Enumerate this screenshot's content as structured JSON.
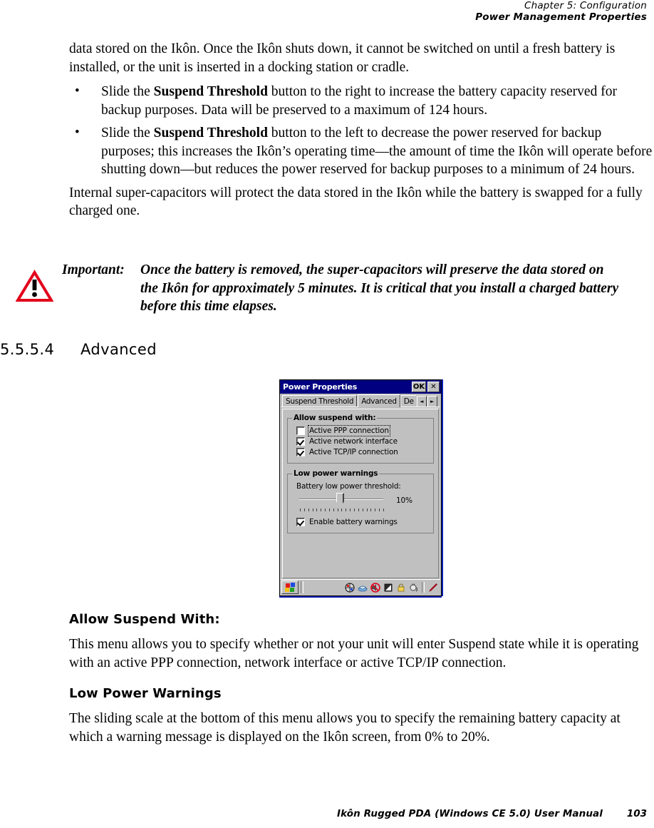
{
  "header": {
    "line1": "Chapter 5: Configuration",
    "line2": "Power Management Properties"
  },
  "body": {
    "intro": "data stored on the Ikôn. Once the Ikôn shuts down, it cannot be switched on until a fresh battery is installed, or the unit is inserted in a docking station or cradle.",
    "bullets": [
      {
        "pre": "Slide the ",
        "bold": "Suspend Threshold",
        "post": " button to the right to increase the battery capacity reserved for backup purposes. Data will be preserved to a maximum of 124 hours."
      },
      {
        "pre": "Slide the ",
        "bold": "Suspend Threshold",
        "post": " button to the left to decrease the power reserved for backup purposes; this increases the Ikôn’s operating time—the amount of time the Ikôn will operate before shutting down—but reduces the power reserved for backup purposes to a minimum of 24 hours."
      }
    ],
    "after_bullets": "Internal super-capacitors will protect the data stored in the Ikôn while the battery is swapped for a fully charged one."
  },
  "callout": {
    "icon": "warning-triangle-icon",
    "icon_color": "#e2001a",
    "label": "Important:",
    "text": "Once the battery is removed, the super-capacitors will preserve the data stored on the Ikôn for approximately 5 minutes. It is critical that you install a charged battery before this time elapses."
  },
  "section": {
    "number": "5.5.5.4",
    "title": "Advanced"
  },
  "screenshot": {
    "window_title": "Power Properties",
    "titlebar_color": "#000080",
    "face_color": "#c0c0c0",
    "buttons": {
      "ok_label": "OK",
      "close_label": "✕"
    },
    "tabs": [
      {
        "label": "Suspend Threshold",
        "active": false
      },
      {
        "label": "Advanced",
        "active": true
      },
      {
        "label": "De",
        "active": false,
        "truncated": true
      }
    ],
    "tab_scroll": {
      "left_label": "◄",
      "right_label": "►"
    },
    "group_suspend": {
      "legend": "Allow suspend with:",
      "items": [
        {
          "label": "Active PPP connection",
          "checked": false,
          "focused": true,
          "mnemonic": "PPP"
        },
        {
          "label": "Active network interface",
          "checked": true,
          "focused": false,
          "mnemonic": "n"
        },
        {
          "label": "Active TCP/IP connection",
          "checked": true,
          "focused": false,
          "mnemonic": "T"
        }
      ]
    },
    "group_lowpower": {
      "legend": "Low power warnings",
      "slider_label": "Battery low power threshold:",
      "slider_mnemonic": "B",
      "slider_value": "10%",
      "slider_position_percent": 50,
      "tick_count": 21,
      "enable_checkbox": {
        "label": "Enable battery warnings",
        "checked": true,
        "mnemonic": "E"
      }
    },
    "taskbar": {
      "start_icon": "windows-start-flag-icon",
      "tray_icons": [
        "network-globe-icon",
        "activesync-icon",
        "volume-muted-icon",
        "battery-icon",
        "lock-icon",
        "ac-power-plug-icon",
        "stylus-pen-icon"
      ]
    }
  },
  "lower": {
    "subhead1": "Allow Suspend With:",
    "para1": "This menu allows you to specify whether or not your unit will enter Suspend state while it is operating with an active PPP connection, network interface or active TCP/IP connection.",
    "subhead2": "Low Power Warnings",
    "para2": "The sliding scale at the bottom of this menu allows you to specify the remaining battery capacity at which a warning message is displayed on the Ikôn screen, from 0% to 20%."
  },
  "footer": {
    "title": "Ikôn Rugged PDA (Windows CE 5.0) User Manual",
    "page": "103"
  }
}
